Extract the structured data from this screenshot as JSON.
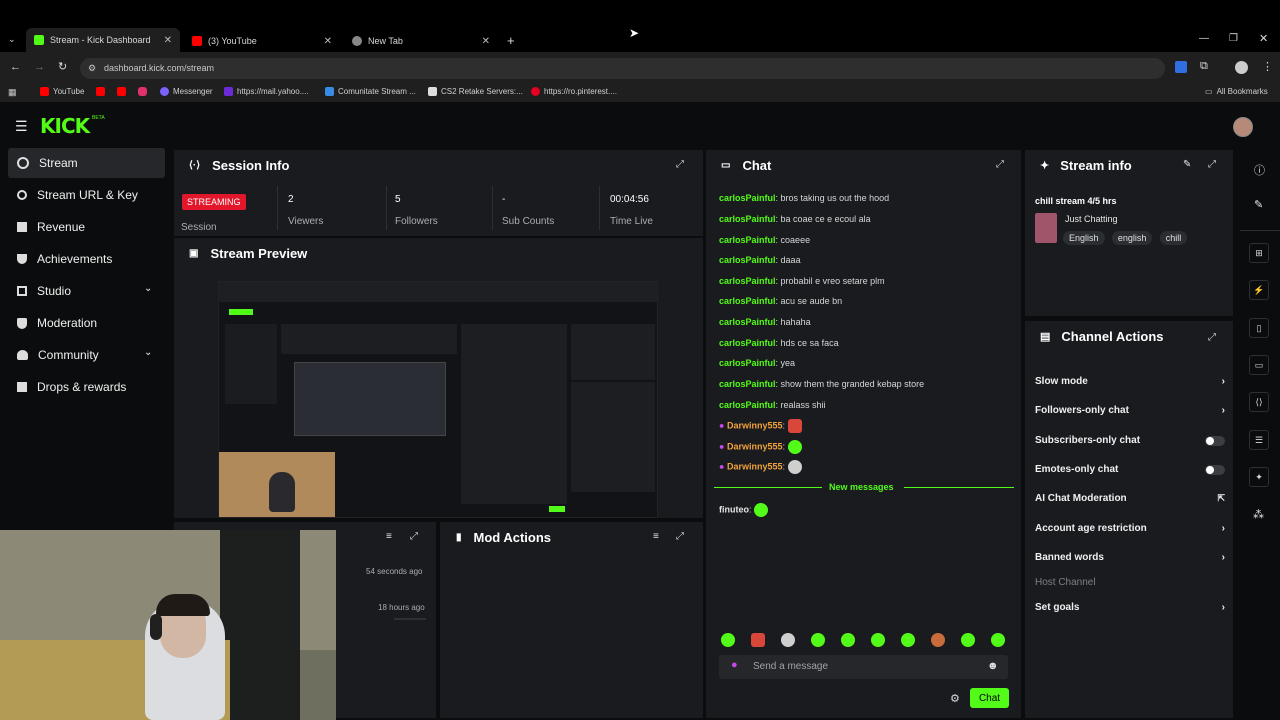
{
  "browser": {
    "tabs": [
      {
        "label": "Stream - Kick Dashboard",
        "color": "#53fc18"
      },
      {
        "label": "(3) YouTube",
        "color": "#ff0000"
      },
      {
        "label": "New Tab",
        "color": "#888888"
      }
    ],
    "url": "dashboard.kick.com/stream",
    "bookmarks": [
      {
        "label": "YouTube",
        "color": "#ff0000"
      },
      {
        "label": "",
        "color": "#ff0000"
      },
      {
        "label": "",
        "color": "#e1306c"
      },
      {
        "label": "Messenger",
        "color": "#7b61ff"
      },
      {
        "label": "https://mail.yahoo....",
        "color": "#6b2bd6"
      },
      {
        "label": "Comunitate Stream ...",
        "color": "#3a8be8"
      },
      {
        "label": "CS2 Retake Servers:...",
        "color": "#dddddd"
      },
      {
        "label": "https://ro.pinterest....",
        "color": "#e60023"
      }
    ],
    "all_bookmarks": "All Bookmarks"
  },
  "app": {
    "logo": "KICK",
    "logo_badge": "BETA",
    "accent": "#53fc18"
  },
  "sidebar": {
    "items": [
      {
        "label": "Stream",
        "icon": "broadcast-icon"
      },
      {
        "label": "Stream URL & Key",
        "icon": "key-icon"
      },
      {
        "label": "Revenue",
        "icon": "revenue-icon"
      },
      {
        "label": "Achievements",
        "icon": "trophy-icon"
      },
      {
        "label": "Studio",
        "icon": "studio-icon"
      },
      {
        "label": "Moderation",
        "icon": "shield-icon"
      },
      {
        "label": "Community",
        "icon": "community-icon"
      },
      {
        "label": "Drops & rewards",
        "icon": "gift-icon"
      }
    ]
  },
  "session": {
    "title": "Session Info",
    "status": "STREAMING",
    "status_label": "Session",
    "stats": [
      {
        "value": "2",
        "label": "Viewers"
      },
      {
        "value": "5",
        "label": "Followers"
      },
      {
        "value": "-",
        "label": "Sub Counts"
      },
      {
        "value": "00:04:56",
        "label": "Time Live"
      }
    ]
  },
  "preview": {
    "title": "Stream Preview"
  },
  "activity": {
    "times": [
      "54 seconds ago",
      "18 hours ago"
    ]
  },
  "mod_actions": {
    "title": "Mod Actions"
  },
  "chat": {
    "title": "Chat",
    "messages": [
      {
        "user": "carlosPainful",
        "text": "bros taking us out the hood"
      },
      {
        "user": "carlosPainful",
        "text": "ba coae ce e ecoul ala"
      },
      {
        "user": "carlosPainful",
        "text": "coaeee"
      },
      {
        "user": "carlosPainful",
        "text": "daaa"
      },
      {
        "user": "carlosPainful",
        "text": "probabil e vreo setare plm"
      },
      {
        "user": "carlosPainful",
        "text": "acu se aude bn"
      },
      {
        "user": "carlosPainful",
        "text": "hahaha"
      },
      {
        "user": "carlosPainful",
        "text": "hds ce sa faca"
      },
      {
        "user": "carlosPainful",
        "text": "yea"
      },
      {
        "user": "carlosPainful",
        "text": "show them the granded kebap store"
      },
      {
        "user": "carlosPainful",
        "text": "realass shii"
      }
    ],
    "emote_messages": [
      {
        "user": "Darwinny555",
        "emote_color": "#d9473b"
      },
      {
        "user": "Darwinny555",
        "emote_color": "#53fc18"
      },
      {
        "user": "Darwinny555",
        "emote_color": "#cfcfcf"
      }
    ],
    "new_messages": "New messages",
    "last_message": {
      "user": "finuteo",
      "emote_color": "#53fc18"
    },
    "placeholder": "Send a message",
    "send_label": "Chat",
    "emote_bar": [
      "#53fc18",
      "#d9473b",
      "#cfcfcf",
      "#53fc18",
      "#53fc18",
      "#53fc18",
      "#53fc18",
      "#c96b3a",
      "#53fc18",
      "#53fc18"
    ]
  },
  "stream_info": {
    "title": "Stream info",
    "stream_title": "chill stream 4/5 hrs",
    "category": "Just Chatting",
    "tags": [
      "English",
      "english",
      "chill"
    ]
  },
  "channel_actions": {
    "title": "Channel Actions",
    "items": [
      {
        "label": "Slow mode",
        "control": "arrow"
      },
      {
        "label": "Followers-only chat",
        "control": "arrow"
      },
      {
        "label": "Subscribers-only chat",
        "control": "toggle"
      },
      {
        "label": "Emotes-only chat",
        "control": "toggle"
      },
      {
        "label": "AI Chat Moderation",
        "control": "external"
      },
      {
        "label": "Account age restriction",
        "control": "arrow"
      },
      {
        "label": "Banned words",
        "control": "arrow"
      },
      {
        "label": "Host Channel",
        "control": "none"
      },
      {
        "label": "Set goals",
        "control": "arrow"
      }
    ]
  }
}
